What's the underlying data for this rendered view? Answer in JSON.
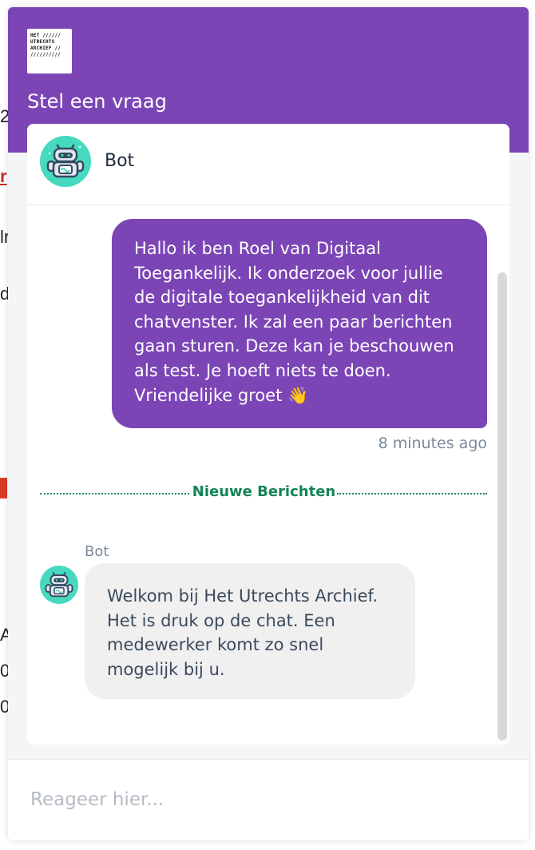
{
  "background_page": {
    "fragments": [
      "2",
      "r",
      "lr",
      "d",
      "A",
      "0",
      "0!"
    ]
  },
  "widget": {
    "logo": {
      "lines": [
        "HET //////",
        "UTRECHTS",
        "ARCHIEF //",
        "//////////"
      ]
    },
    "title": "Stel een vraag",
    "agent": {
      "name": "Bot",
      "avatar_icon": "robot-icon"
    },
    "messages": [
      {
        "direction": "outgoing",
        "text": "Hallo ik ben Roel van Digitaal Toegankelijk. Ik onderzoek voor jullie de digitale toegankelijkheid van dit chatvenster. Ik zal een paar berichten gaan sturen. Deze kan je beschouwen als test. Je hoeft niets te doen. Vriendelijke groet 👋",
        "time": "8 minutes ago"
      },
      {
        "direction": "incoming",
        "sender": "Bot",
        "text": "Welkom bij Het Utrechts Archief. Het is druk op de chat. Een medewerker komt zo snel mogelijk bij u."
      }
    ],
    "new_messages_divider": "Nieuwe Berichten",
    "composer": {
      "placeholder": "Reageer hier...",
      "value": ""
    }
  },
  "colors": {
    "brand_purple": "#7c45b6",
    "divider_green": "#138458",
    "muted_text": "#7b8a9b",
    "incoming_bubble": "#f0f0f0"
  }
}
